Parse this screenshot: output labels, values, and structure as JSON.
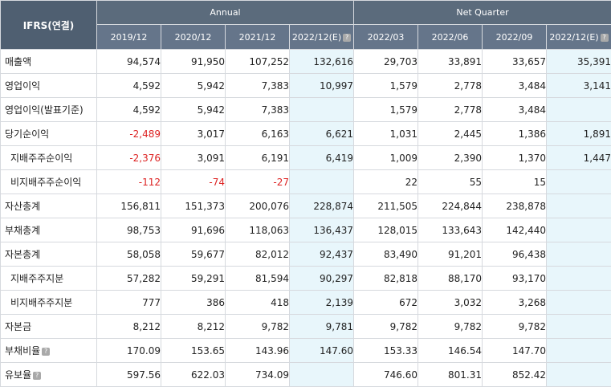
{
  "header": {
    "corner": "IFRS(연결)",
    "annual_label": "Annual",
    "quarter_label": "Net Quarter",
    "help_glyph": "?",
    "periods": [
      "2019/12",
      "2020/12",
      "2021/12",
      "2022/12(E)",
      "2022/03",
      "2022/06",
      "2022/09",
      "2022/12(E)"
    ]
  },
  "rows": [
    {
      "label": "매출액",
      "sub": false,
      "help": false,
      "values": [
        "94,574",
        "91,950",
        "107,252",
        "132,616",
        "29,703",
        "33,891",
        "33,657",
        "35,391"
      ]
    },
    {
      "label": "영업이익",
      "sub": false,
      "help": false,
      "values": [
        "4,592",
        "5,942",
        "7,383",
        "10,997",
        "1,579",
        "2,778",
        "3,484",
        "3,141"
      ]
    },
    {
      "label": "영업이익(발표기준)",
      "sub": false,
      "help": false,
      "values": [
        "4,592",
        "5,942",
        "7,383",
        "",
        "1,579",
        "2,778",
        "3,484",
        ""
      ]
    },
    {
      "label": "당기순이익",
      "sub": false,
      "help": false,
      "values": [
        "-2,489",
        "3,017",
        "6,163",
        "6,621",
        "1,031",
        "2,445",
        "1,386",
        "1,891"
      ]
    },
    {
      "label": "지배주주순이익",
      "sub": true,
      "help": false,
      "values": [
        "-2,376",
        "3,091",
        "6,191",
        "6,419",
        "1,009",
        "2,390",
        "1,370",
        "1,447"
      ]
    },
    {
      "label": "비지배주주순이익",
      "sub": true,
      "help": false,
      "values": [
        "-112",
        "-74",
        "-27",
        "",
        "22",
        "55",
        "15",
        ""
      ]
    },
    {
      "label": "자산총계",
      "sub": false,
      "help": false,
      "values": [
        "156,811",
        "151,373",
        "200,076",
        "228,874",
        "211,505",
        "224,844",
        "238,878",
        ""
      ]
    },
    {
      "label": "부채총계",
      "sub": false,
      "help": false,
      "values": [
        "98,753",
        "91,696",
        "118,063",
        "136,437",
        "128,015",
        "133,643",
        "142,440",
        ""
      ]
    },
    {
      "label": "자본총계",
      "sub": false,
      "help": false,
      "values": [
        "58,058",
        "59,677",
        "82,012",
        "92,437",
        "83,490",
        "91,201",
        "96,438",
        ""
      ]
    },
    {
      "label": "지배주주지분",
      "sub": true,
      "help": false,
      "values": [
        "57,282",
        "59,291",
        "81,594",
        "90,297",
        "82,818",
        "88,170",
        "93,170",
        ""
      ]
    },
    {
      "label": "비지배주주지분",
      "sub": true,
      "help": false,
      "values": [
        "777",
        "386",
        "418",
        "2,139",
        "672",
        "3,032",
        "3,268",
        ""
      ]
    },
    {
      "label": "자본금",
      "sub": false,
      "help": false,
      "values": [
        "8,212",
        "8,212",
        "9,782",
        "9,781",
        "9,782",
        "9,782",
        "9,782",
        ""
      ]
    },
    {
      "label": "부채비율",
      "sub": false,
      "help": true,
      "values": [
        "170.09",
        "153.65",
        "143.96",
        "147.60",
        "153.33",
        "146.54",
        "147.70",
        ""
      ]
    },
    {
      "label": "유보율",
      "sub": false,
      "help": true,
      "values": [
        "597.56",
        "622.03",
        "734.09",
        "",
        "746.60",
        "801.31",
        "852.42",
        ""
      ]
    }
  ],
  "colors": {
    "header": "#5b6b7c",
    "estimate_bg": "#e8f6fb",
    "negative": "#d22222",
    "border": "#d6d9de"
  }
}
